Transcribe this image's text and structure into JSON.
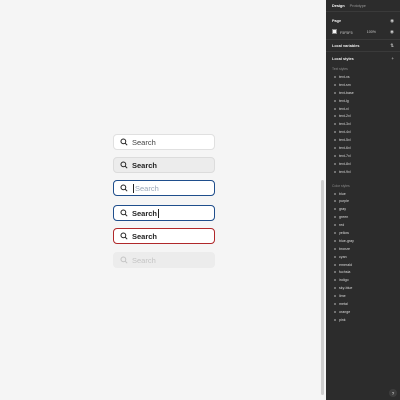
{
  "inputs": [
    {
      "state": "default",
      "text": "Search"
    },
    {
      "state": "filled",
      "text": "Search"
    },
    {
      "state": "focus",
      "text": "Search"
    },
    {
      "state": "typing",
      "text": "Search"
    },
    {
      "state": "error",
      "text": "Search"
    },
    {
      "state": "disabled",
      "text": "Search"
    }
  ],
  "panel": {
    "tabs": {
      "design": "Design",
      "prototype": "Prototype"
    },
    "page": {
      "title": "Page",
      "color_hex": "F5F5F5",
      "opacity": "100%",
      "color": "#f5f5f5"
    },
    "local_variables": "Local variables",
    "local_styles": "Local styles",
    "text_styles_label": "Text styles",
    "text_styles": [
      "text-xs",
      "text-sm",
      "text-base",
      "text-lg",
      "text-xl",
      "text-2xl",
      "text-3xl",
      "text-4xl",
      "text-5xl",
      "text-6xl",
      "text-7xl",
      "text-8xl",
      "text-9xl"
    ],
    "color_styles_label": "Color styles",
    "color_styles": [
      "blue",
      "purple",
      "gray",
      "green",
      "red",
      "yellow",
      "blue-gray",
      "bronze",
      "cyan",
      "emerald",
      "fuchsia",
      "indigo",
      "sky-blue",
      "lime",
      "metal",
      "orange",
      "pink"
    ],
    "help": "?"
  },
  "colors": {
    "focus_border": "#1f4e8c",
    "error_border": "#b0282a",
    "panel_bg": "#2c2c2c"
  }
}
